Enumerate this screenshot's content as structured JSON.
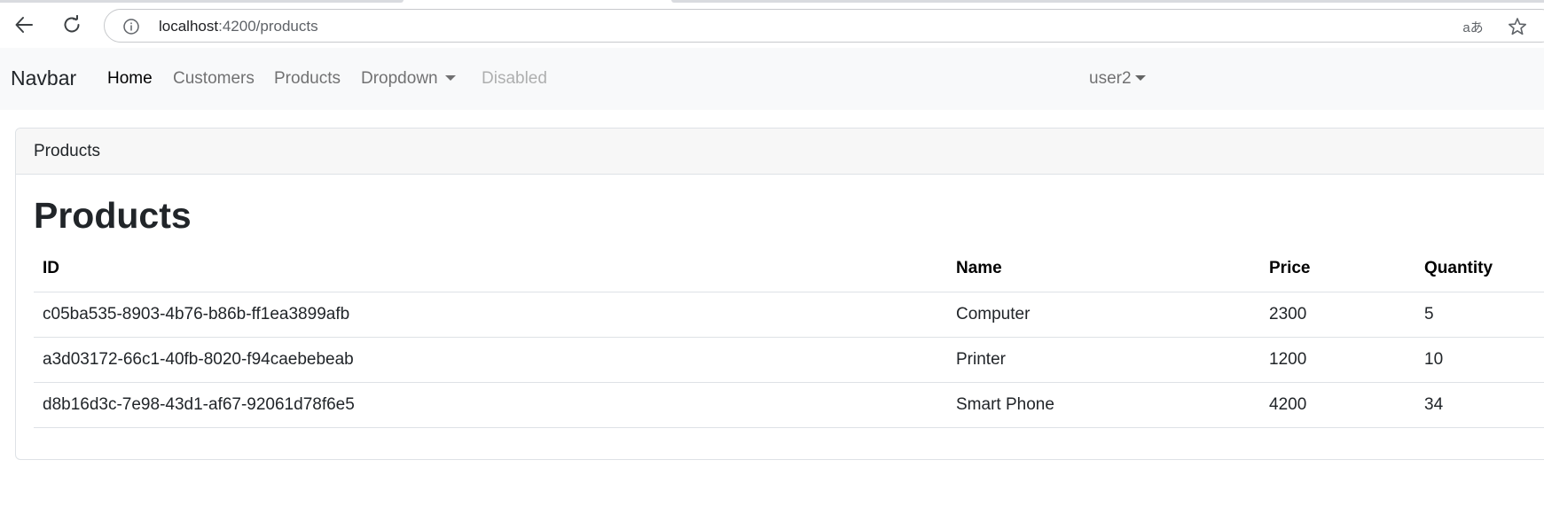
{
  "browser": {
    "url_host": "localhost",
    "url_path": ":4200/products",
    "icons": {
      "back": "arrow-left-icon",
      "reload": "reload-icon",
      "info": "info-icon",
      "translate": "translate-icon",
      "bookmark": "star-icon"
    },
    "translate_glyph": "aあ"
  },
  "navbar": {
    "brand": "Navbar",
    "links": {
      "home": "Home",
      "customers": "Customers",
      "products": "Products",
      "dropdown": "Dropdown",
      "disabled": "Disabled"
    },
    "user": "user2"
  },
  "card": {
    "header": "Products",
    "title": "Products"
  },
  "table": {
    "columns": [
      "ID",
      "Name",
      "Price",
      "Quantity"
    ],
    "rows": [
      [
        "c05ba535-8903-4b76-b86b-ff1ea3899afb",
        "Computer",
        "2300",
        "5"
      ],
      [
        "a3d03172-66c1-40fb-8020-f94caebebeab",
        "Printer",
        "1200",
        "10"
      ],
      [
        "d8b16d3c-7e98-43d1-af67-92061d78f6e5",
        "Smart Phone",
        "4200",
        "34"
      ]
    ]
  },
  "colors": {
    "navbar_bg": "#f8f9fa",
    "card_header_bg": "#f7f7f7",
    "border": "#dee2e6",
    "text": "#212529"
  }
}
